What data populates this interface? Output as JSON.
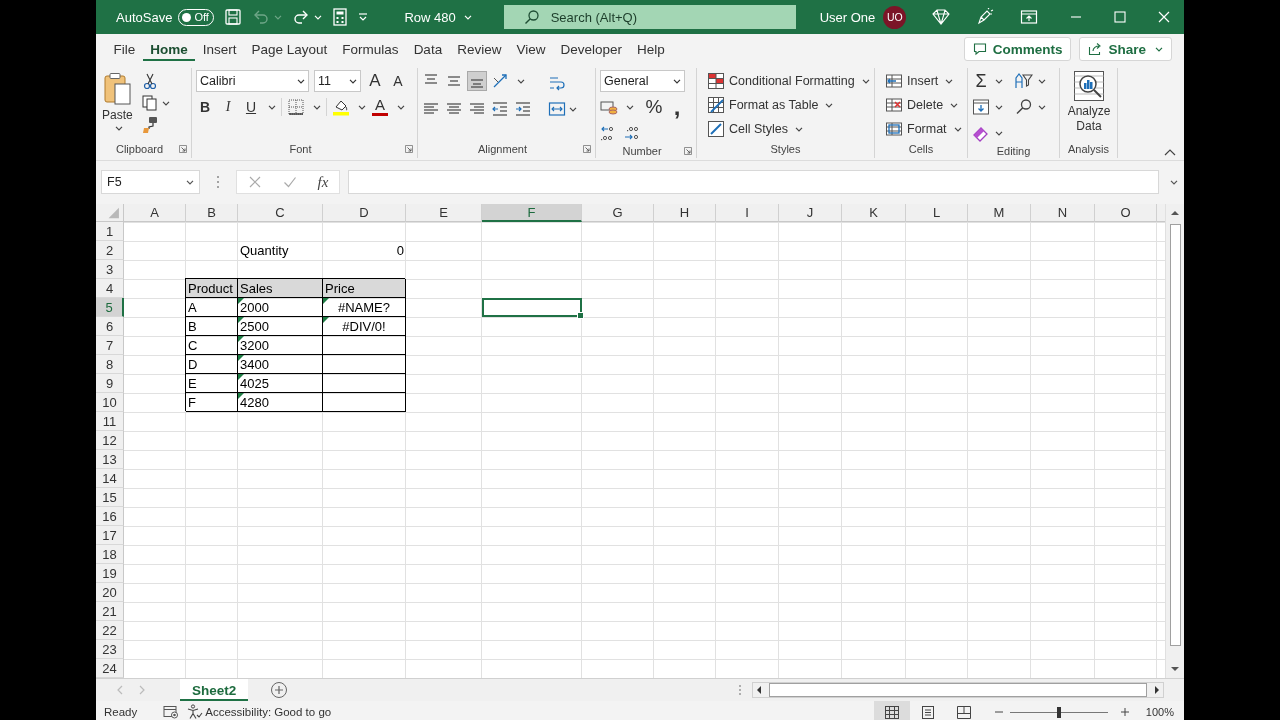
{
  "title_bar": {
    "autosave": {
      "label": "AutoSave",
      "state_label": "Off",
      "on": false
    },
    "undo_disabled": true,
    "document": "Row 480",
    "search": {
      "placeholder": "Search (Alt+Q)"
    },
    "user": {
      "name": "User One",
      "initials": "UO"
    }
  },
  "menu_tabs": [
    {
      "label": "File",
      "selected": false
    },
    {
      "label": "Home",
      "selected": true
    },
    {
      "label": "Insert",
      "selected": false
    },
    {
      "label": "Page Layout",
      "selected": false
    },
    {
      "label": "Formulas",
      "selected": false
    },
    {
      "label": "Data",
      "selected": false
    },
    {
      "label": "Review",
      "selected": false
    },
    {
      "label": "View",
      "selected": false
    },
    {
      "label": "Developer",
      "selected": false
    },
    {
      "label": "Help",
      "selected": false
    }
  ],
  "comments": "Comments",
  "share": "Share",
  "ribbon": {
    "clipboard": {
      "label": "Clipboard",
      "paste": "Paste"
    },
    "font": {
      "label": "Font",
      "font_name": "Calibri",
      "font_size": "11",
      "grow": "A",
      "shrink": "A",
      "bold": "B",
      "italic": "I",
      "underline": "U",
      "font_color": "A"
    },
    "alignment": {
      "label": "Alignment"
    },
    "number": {
      "label": "Number",
      "format": "General",
      "percent": "%",
      "comma": ","
    },
    "styles": {
      "label": "Styles",
      "buttons": [
        "Conditional Formatting",
        "Format as Table",
        "Cell Styles"
      ]
    },
    "cells": {
      "label": "Cells",
      "buttons": [
        "Insert",
        "Delete",
        "Format"
      ]
    },
    "editing": {
      "label": "Editing",
      "sum": "Σ"
    },
    "analysis": {
      "label": "Analysis",
      "button": "Analyze Data"
    }
  },
  "formula_bar": {
    "name_box": "F5",
    "function_label": "fx"
  },
  "sheet": {
    "columns": [
      {
        "label": "A",
        "selected": false
      },
      {
        "label": "B",
        "selected": false
      },
      {
        "label": "C",
        "selected": false
      },
      {
        "label": "D",
        "selected": false
      },
      {
        "label": "E",
        "selected": false
      },
      {
        "label": "F",
        "selected": true
      },
      {
        "label": "G",
        "selected": false
      },
      {
        "label": "H",
        "selected": false
      },
      {
        "label": "I",
        "selected": false
      },
      {
        "label": "J",
        "selected": false
      },
      {
        "label": "K",
        "selected": false
      },
      {
        "label": "L",
        "selected": false
      },
      {
        "label": "M",
        "selected": false
      },
      {
        "label": "N",
        "selected": false
      },
      {
        "label": "O",
        "selected": false
      }
    ],
    "rows": [
      {
        "label": "1",
        "selected": false
      },
      {
        "label": "2",
        "selected": false,
        "cells": [
          {
            "kind": "blank",
            "flagged": false,
            "selected": false
          },
          {
            "kind": "blank",
            "flagged": false,
            "selected": false
          },
          {
            "kind": "label",
            "text": "Quantity",
            "flagged": false,
            "selected": false
          },
          {
            "kind": "number",
            "text": "0",
            "flagged": false,
            "selected": false
          }
        ]
      },
      {
        "label": "3",
        "selected": false
      },
      {
        "label": "4",
        "selected": false,
        "cells": [
          {
            "kind": "blank",
            "flagged": false,
            "selected": false
          },
          {
            "kind": "table_header",
            "text": "Product",
            "flagged": false,
            "selected": false
          },
          {
            "kind": "table_header",
            "text": "Sales",
            "flagged": false,
            "selected": false
          },
          {
            "kind": "table_header",
            "text": "Price",
            "flagged": false,
            "selected": false
          }
        ]
      },
      {
        "label": "5",
        "selected": true,
        "cells": [
          {
            "kind": "blank",
            "flagged": false,
            "selected": false
          },
          {
            "kind": "table_text",
            "text": "A",
            "flagged": false,
            "selected": false
          },
          {
            "kind": "table_text",
            "text": "2000",
            "flagged": true,
            "selected": false
          },
          {
            "kind": "table_error",
            "text": "#NAME?",
            "flagged": true,
            "selected": false
          },
          {
            "kind": "blank",
            "flagged": false,
            "selected": false
          },
          {
            "kind": "blank",
            "flagged": false,
            "selected": true
          }
        ]
      },
      {
        "label": "6",
        "selected": false,
        "cells": [
          {
            "kind": "blank",
            "flagged": false,
            "selected": false
          },
          {
            "kind": "table_text",
            "text": "B",
            "flagged": false,
            "selected": false
          },
          {
            "kind": "table_text",
            "text": "2500",
            "flagged": true,
            "selected": false
          },
          {
            "kind": "table_error",
            "text": "#DIV/0!",
            "flagged": true,
            "selected": false
          }
        ]
      },
      {
        "label": "7",
        "selected": false,
        "cells": [
          {
            "kind": "blank",
            "flagged": false,
            "selected": false
          },
          {
            "kind": "table_text",
            "text": "C",
            "flagged": false,
            "selected": false
          },
          {
            "kind": "table_text",
            "text": "3200",
            "flagged": true,
            "selected": false
          },
          {
            "kind": "table_blank",
            "flagged": false,
            "selected": false
          }
        ]
      },
      {
        "label": "8",
        "selected": false,
        "cells": [
          {
            "kind": "blank",
            "flagged": false,
            "selected": false
          },
          {
            "kind": "table_text",
            "text": "D",
            "flagged": false,
            "selected": false
          },
          {
            "kind": "table_text",
            "text": "3400",
            "flagged": true,
            "selected": false
          },
          {
            "kind": "table_blank",
            "flagged": false,
            "selected": false
          }
        ]
      },
      {
        "label": "9",
        "selected": false,
        "cells": [
          {
            "kind": "blank",
            "flagged": false,
            "selected": false
          },
          {
            "kind": "table_text",
            "text": "E",
            "flagged": false,
            "selected": false
          },
          {
            "kind": "table_text",
            "text": "4025",
            "flagged": true,
            "selected": false
          },
          {
            "kind": "table_blank",
            "flagged": false,
            "selected": false
          }
        ]
      },
      {
        "label": "10",
        "selected": false,
        "cells": [
          {
            "kind": "blank",
            "flagged": false,
            "selected": false
          },
          {
            "kind": "table_text",
            "text": "F",
            "flagged": false,
            "selected": false
          },
          {
            "kind": "table_text",
            "text": "4280",
            "flagged": true,
            "selected": false
          },
          {
            "kind": "table_blank",
            "flagged": false,
            "selected": false
          }
        ]
      },
      {
        "label": "11",
        "selected": false
      },
      {
        "label": "12",
        "selected": false
      },
      {
        "label": "13",
        "selected": false
      },
      {
        "label": "14",
        "selected": false
      },
      {
        "label": "15",
        "selected": false
      },
      {
        "label": "16",
        "selected": false
      },
      {
        "label": "17",
        "selected": false
      },
      {
        "label": "18",
        "selected": false
      },
      {
        "label": "19",
        "selected": false
      },
      {
        "label": "20",
        "selected": false
      },
      {
        "label": "21",
        "selected": false
      },
      {
        "label": "22",
        "selected": false
      },
      {
        "label": "23",
        "selected": false
      },
      {
        "label": "24",
        "selected": false
      }
    ]
  },
  "sheet_tabs": [
    {
      "label": "Sheet2",
      "selected": true
    }
  ],
  "status_bar": {
    "mode": "Ready",
    "accessibility": "Accessibility: Good to go",
    "views": [
      {
        "kind": "normal",
        "selected": true
      },
      {
        "kind": "page_layout",
        "selected": false
      },
      {
        "kind": "page_break",
        "selected": false
      }
    ],
    "zoom": {
      "level": 0.5,
      "reading": "100%"
    }
  }
}
